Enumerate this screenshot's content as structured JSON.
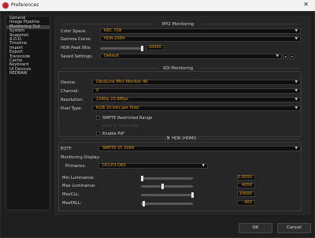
{
  "window": {
    "title": "Preferences",
    "close_symbol": "✕"
  },
  "sidebar": {
    "items": [
      {
        "label": "General",
        "selected": false
      },
      {
        "label": "Image Pipeline",
        "selected": false
      },
      {
        "label": "Monitoring Out",
        "selected": true
      },
      {
        "label": "System",
        "selected": false
      },
      {
        "label": "Snapshot",
        "selected": false
      },
      {
        "label": "A.D.D.",
        "selected": false
      },
      {
        "label": "Timeline",
        "selected": false
      },
      {
        "label": "Import",
        "selected": false
      },
      {
        "label": "Export",
        "selected": false
      },
      {
        "label": "Transcode",
        "selected": false
      },
      {
        "label": "Cache",
        "selected": false
      },
      {
        "label": "Keyboard",
        "selected": false
      },
      {
        "label": "UI Devices",
        "selected": false
      },
      {
        "label": "REDRAW",
        "selected": false
      }
    ]
  },
  "ipp2": {
    "title": "IPP2 Monitoring",
    "color_space_label": "Color Space:",
    "color_space_value": "REC 709",
    "gamma_label": "Gamma Curve:",
    "gamma_value": "HDR-2084",
    "peak_label": "HDR Peak Nits:",
    "peak_value": "10000",
    "peak_fraction": 0.97,
    "saved_label": "Saved Settings:",
    "saved_value": "Default"
  },
  "sdi": {
    "title": "SDI Monitoring",
    "device_label": "Device:",
    "device_value": "DeckLink Mini Monitor 4K",
    "channel_label": "Channel:",
    "channel_value": "0",
    "resolution_label": "Resolution:",
    "resolution_value": "1080p 23.98fps",
    "pixel_label": "Pixel Type:",
    "pixel_value": "RGB 10-bits per Pixel",
    "smpte_label": "SMPTE Restricted Range",
    "smpte_checked": false,
    "lock_label": "Lock to Timecode",
    "pdf_label": "Enable PsF",
    "pdf_checked": false
  },
  "hdr": {
    "title": "HDR (HDMI)",
    "checked": true,
    "eotf_label": "EOTF:",
    "eotf_value": "SMPTE ST 2084",
    "display_label": "Monitoring Display:",
    "primaries_label": "Primaries:",
    "primaries_value": "DCI-P3 D65",
    "min_lum_label": "Min Luminance:",
    "min_lum_value": "0.0050",
    "min_lum_fraction": 0.0,
    "max_lum_label": "Max Luminance:",
    "max_lum_value": "4000",
    "max_lum_fraction": 0.4,
    "maxcll_label": "MaxCLL:",
    "maxcll_value": "10000",
    "maxcll_fraction": 0.97,
    "maxfall_label": "MaxFALL:",
    "maxfall_value": "400",
    "maxfall_fraction": 0.04
  },
  "buttons": {
    "ok": "OK",
    "cancel": "Cancel"
  }
}
